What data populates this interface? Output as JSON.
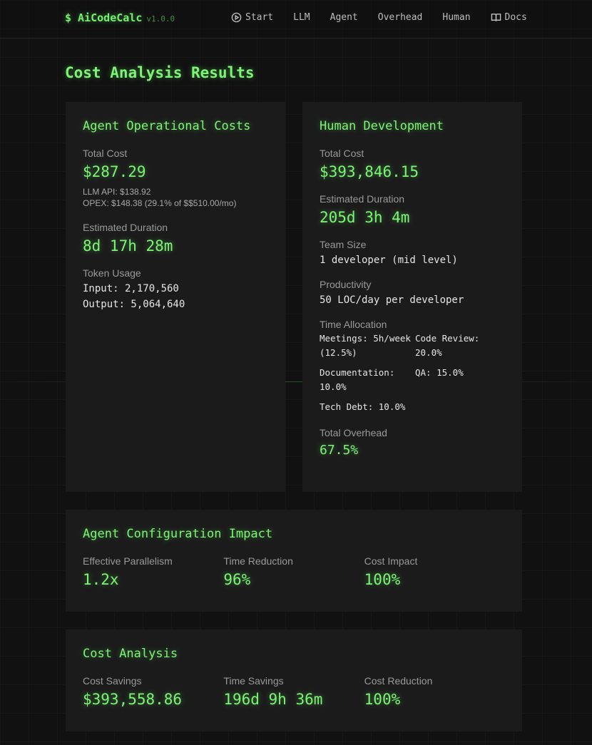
{
  "header": {
    "logo": "$ AiCodeCalc",
    "version": "v1.0.0",
    "nav": [
      {
        "label": "Start",
        "icon": "play-circle-icon"
      },
      {
        "label": "LLM"
      },
      {
        "label": "Agent"
      },
      {
        "label": "Overhead"
      },
      {
        "label": "Human"
      },
      {
        "label": "Docs",
        "icon": "book-icon"
      }
    ]
  },
  "page_title": "Cost Analysis Results",
  "agent_costs": {
    "title": "Agent Operational Costs",
    "total_cost_label": "Total Cost",
    "total_cost": "$287.29",
    "llm_api": "LLM API: $138.92",
    "opex": "OPEX: $148.38 (29.1% of $$510.00/mo)",
    "duration_label": "Estimated Duration",
    "duration": "8d 17h 28m",
    "token_label": "Token Usage",
    "input": "Input: 2,170,560",
    "output": "Output: 5,064,640"
  },
  "human_dev": {
    "title": "Human Development",
    "total_cost_label": "Total Cost",
    "total_cost": "$393,846.15",
    "duration_label": "Estimated Duration",
    "duration": "205d 3h 4m",
    "team_label": "Team Size",
    "team": "1 developer (mid level)",
    "productivity_label": "Productivity",
    "productivity": "50 LOC/day per developer",
    "allocation_label": "Time Allocation",
    "allocation": [
      "Meetings: 5h/week (12.5%)",
      "Code Review: 20.0%",
      "Documentation: 10.0%",
      "QA: 15.0%",
      "Tech Debt: 10.0%"
    ],
    "overhead_label": "Total Overhead",
    "overhead": "67.5%"
  },
  "agent_config": {
    "title": "Agent Configuration Impact",
    "items": [
      {
        "label": "Effective Parallelism",
        "value": "1.2x"
      },
      {
        "label": "Time Reduction",
        "value": "96%"
      },
      {
        "label": "Cost Impact",
        "value": "100%"
      }
    ]
  },
  "cost_analysis": {
    "title": "Cost Analysis",
    "items": [
      {
        "label": "Cost Savings",
        "value": "$393,558.86"
      },
      {
        "label": "Time Savings",
        "value": "196d 9h 36m"
      },
      {
        "label": "Cost Reduction",
        "value": "100%"
      }
    ]
  },
  "colors": {
    "accent": "#7cf575",
    "background": "#111111",
    "card": "#1b1b1b"
  }
}
